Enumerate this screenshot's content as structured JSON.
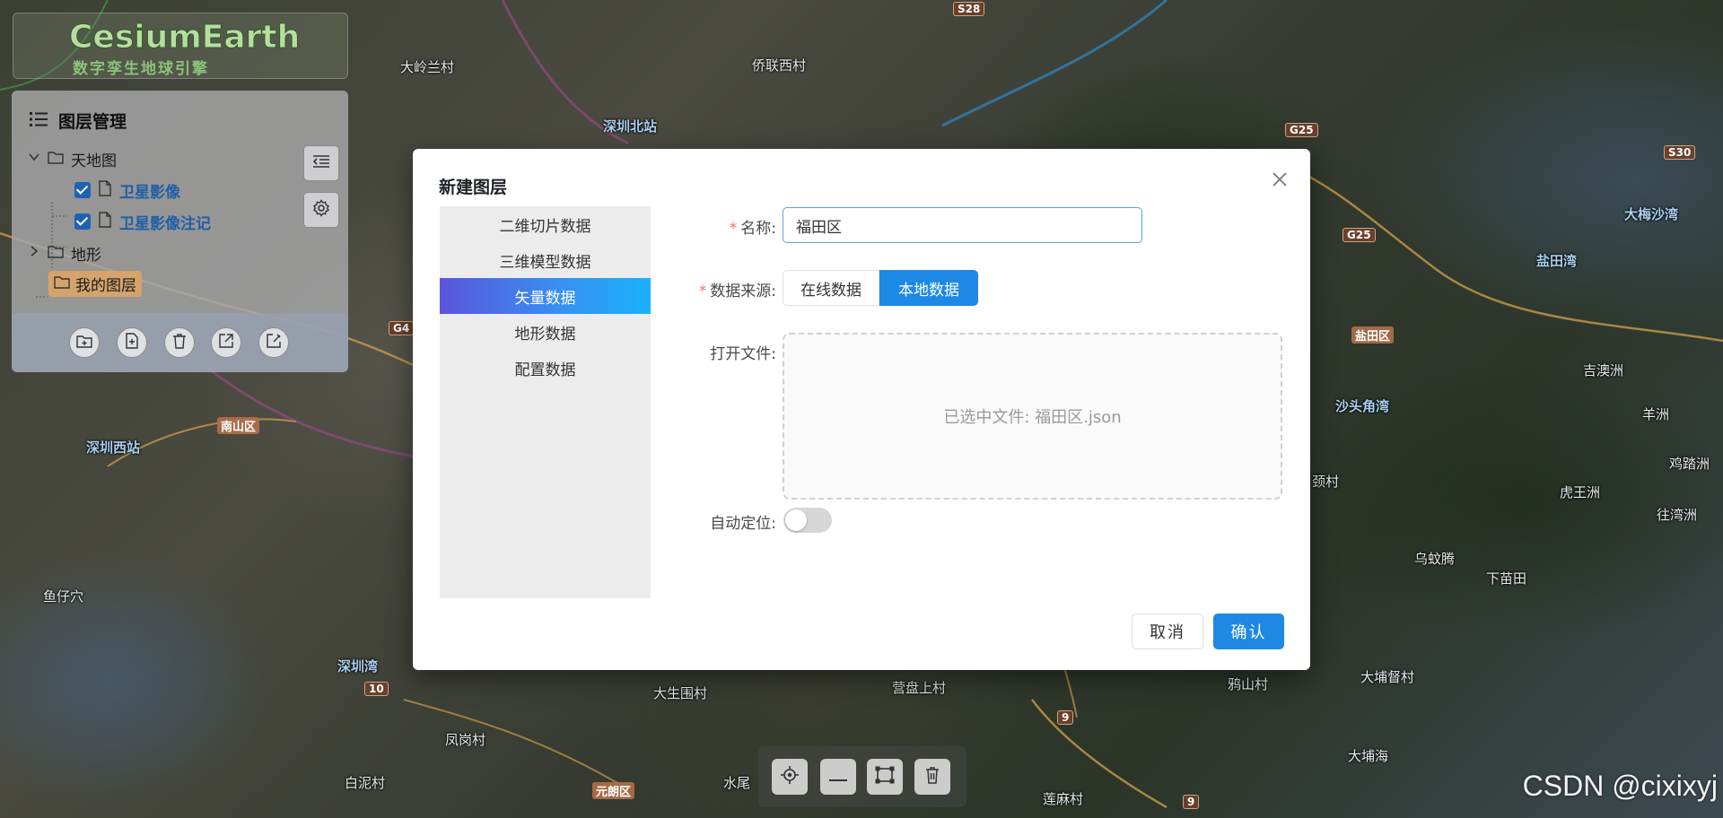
{
  "logo": {
    "title": "CesiumEarth",
    "subtitle": "数字孪生地球引擎"
  },
  "layer_panel": {
    "title": "图层管理",
    "tree": [
      {
        "label": "天地图",
        "expanded": true,
        "children": [
          {
            "label": "卫星影像",
            "checked": true
          },
          {
            "label": "卫星影像注记",
            "checked": true
          }
        ]
      },
      {
        "label": "地形",
        "expanded": false
      },
      {
        "label": "我的图层",
        "selected": true
      }
    ],
    "side_buttons": [
      "list-indent-icon",
      "gear-icon"
    ],
    "footer_buttons": [
      "folder-add-icon",
      "file-add-icon",
      "trash-icon",
      "export-icon",
      "edit-icon"
    ]
  },
  "map_labels": {
    "daping": "大岭兰村",
    "qiaolian": "侨联西村",
    "shenzhen_north": "深圳北站",
    "nanshan": "南山区",
    "shenzhen_west": "深圳西站",
    "yuzaixue": "鱼仔穴",
    "shenzhen_bay": "深圳湾",
    "dameisha": "大梅沙湾",
    "yantian_bay": "盐田湾",
    "yantian_district": "盐田区",
    "shatoujiao": "沙头角湾",
    "jiling": "吉澳洲",
    "yangzhou": "羊洲",
    "huwangzhou": "虎王洲",
    "wutou": "乌蚊腾",
    "xiamiaotian": "下苗田",
    "dashe": "大埔督村",
    "yashan": "鸦山村",
    "dapuhai": "大埔海",
    "hudongzhou": "往湾洲",
    "yinpan": "营盘上村",
    "daweiwei": "大生围村",
    "fenggang": "凤岗村",
    "baini": "白泥村",
    "yuanlang": "元朗区",
    "shuiwei": "水尾",
    "lianma": "莲麻村",
    "banjiao": "颈村",
    "dalu": "鸡踏洲"
  },
  "road_shields": [
    "S28",
    "G25",
    "S30",
    "G25",
    "G4",
    "10",
    "9",
    "9"
  ],
  "map_toolbar": [
    "locate-icon",
    "minus-icon",
    "bbox-icon",
    "trash-icon"
  ],
  "watermark": "CSDN @cixixyj",
  "dialog": {
    "title": "新建图层",
    "types": [
      "二维切片数据",
      "三维模型数据",
      "矢量数据",
      "地形数据",
      "配置数据"
    ],
    "active_type": "矢量数据",
    "form": {
      "name_label": "名称:",
      "name_value": "福田区",
      "source_label": "数据来源:",
      "source_options": [
        "在线数据",
        "本地数据"
      ],
      "source_selected": "本地数据",
      "file_label": "打开文件:",
      "file_selected_text": "已选中文件: 福田区.json",
      "auto_locate_label": "自动定位:",
      "auto_locate": false
    },
    "cancel_label": "取消",
    "confirm_label": "确认"
  },
  "colors": {
    "primary": "#1e88e5",
    "required": "#f56c6c",
    "active_grad_start": "#5a55dc",
    "active_grad_end": "#19b2fb"
  }
}
